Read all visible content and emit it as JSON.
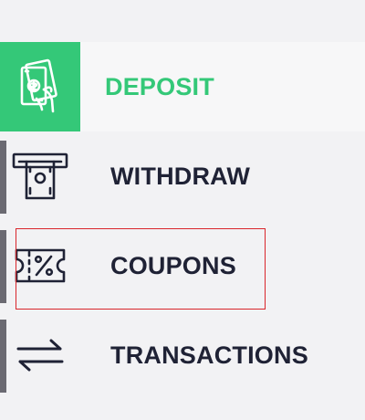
{
  "menu": {
    "items": [
      {
        "label": "DEPOSIT",
        "icon": "cash-deposit-icon",
        "active": true
      },
      {
        "label": "WITHDRAW",
        "icon": "atm-withdraw-icon",
        "active": false
      },
      {
        "label": "COUPONS",
        "icon": "coupon-ticket-icon",
        "active": false,
        "focused": true
      },
      {
        "label": "TRANSACTIONS",
        "icon": "transfer-arrows-icon",
        "active": false
      }
    ]
  },
  "colors": {
    "accent": "#34c878",
    "text": "#1f2235",
    "background": "#f2f2f4",
    "indicator": "#6b6a72",
    "focus_outline": "#d9262b"
  }
}
